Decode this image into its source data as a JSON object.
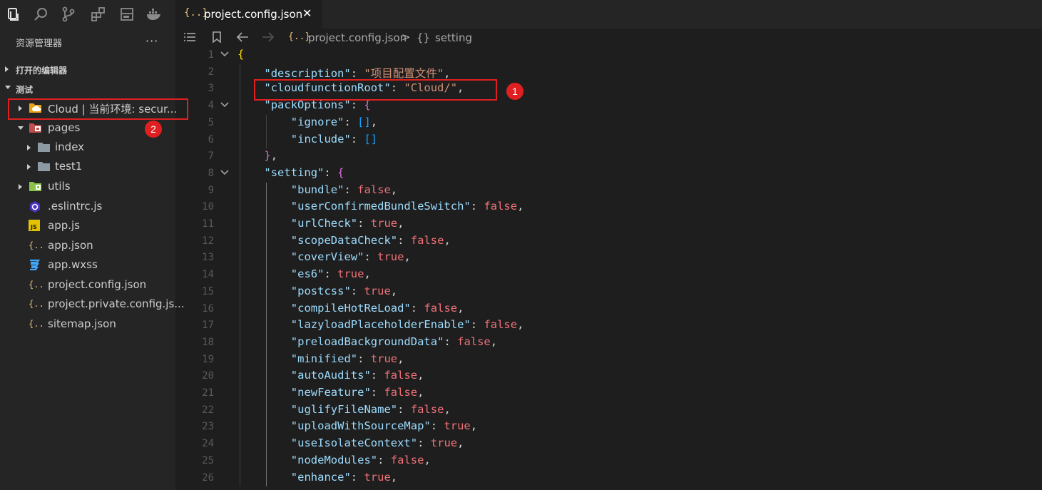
{
  "activity_icons": [
    "explorer-icon",
    "search-icon",
    "source-control-icon",
    "extensions-icon",
    "layout-icon",
    "docker-icon"
  ],
  "explorer": {
    "title": "资源管理器",
    "more": "···",
    "open_editors": "打开的编辑器",
    "workspace": "测试",
    "tree": [
      {
        "label": "Cloud | 当前环境: secur...",
        "icon": "cloud-folder-icon",
        "indent": 0,
        "expandable": true
      },
      {
        "label": "pages",
        "icon": "pages-folder-icon",
        "indent": 0,
        "expandable": true,
        "expanded": true
      },
      {
        "label": "index",
        "icon": "folder-icon",
        "indent": 1,
        "expandable": true
      },
      {
        "label": "test1",
        "icon": "folder-icon",
        "indent": 1,
        "expandable": true
      },
      {
        "label": "utils",
        "icon": "utils-folder-icon",
        "indent": 0,
        "expandable": true
      },
      {
        "label": ".eslintrc.js",
        "icon": "eslint-icon",
        "indent": 0
      },
      {
        "label": "app.js",
        "icon": "js-icon",
        "indent": 0
      },
      {
        "label": "app.json",
        "icon": "json-icon",
        "indent": 0
      },
      {
        "label": "app.wxss",
        "icon": "css-icon",
        "indent": 0
      },
      {
        "label": "project.config.json",
        "icon": "json-icon",
        "indent": 0
      },
      {
        "label": "project.private.config.js...",
        "icon": "json-icon",
        "indent": 0
      },
      {
        "label": "sitemap.json",
        "icon": "json-icon",
        "indent": 0
      }
    ]
  },
  "tab": {
    "icon": "{..}",
    "label": "project.config.json",
    "close": "✕"
  },
  "breadcrumb": {
    "file_icon": "{..}",
    "file": "project.config.json",
    "sep": ">",
    "obj_icon": "{}",
    "setting": "setting"
  },
  "annotations": {
    "badge1": "1",
    "badge2": "2"
  },
  "code": [
    {
      "n": "1",
      "fold": true,
      "parts": [
        [
          "br",
          "{"
        ]
      ]
    },
    {
      "n": "2",
      "parts": [
        [
          "k",
          "\"description\""
        ],
        [
          "p",
          ": "
        ],
        [
          "s",
          "\"项目配置文件\""
        ],
        [
          "p",
          ","
        ]
      ]
    },
    {
      "n": "3",
      "parts": [
        [
          "k",
          "\"cloudfunctionRoot\""
        ],
        [
          "p",
          ": "
        ],
        [
          "s",
          "\"Cloud/\""
        ],
        [
          "p",
          ","
        ]
      ]
    },
    {
      "n": "4",
      "fold": true,
      "parts": [
        [
          "k",
          "\"packOptions\""
        ],
        [
          "p",
          ": "
        ],
        [
          "br2",
          "{"
        ]
      ]
    },
    {
      "n": "5",
      "parts": [
        [
          "k",
          "\"ignore\""
        ],
        [
          "p",
          ": "
        ],
        [
          "br3",
          "[]"
        ],
        [
          "p",
          ","
        ]
      ]
    },
    {
      "n": "6",
      "parts": [
        [
          "k",
          "\"include\""
        ],
        [
          "p",
          ": "
        ],
        [
          "br3",
          "[]"
        ]
      ]
    },
    {
      "n": "7",
      "parts": [
        [
          "br2",
          "}"
        ],
        [
          "p",
          ","
        ]
      ]
    },
    {
      "n": "8",
      "fold": true,
      "parts": [
        [
          "k",
          "\"setting\""
        ],
        [
          "p",
          ": "
        ],
        [
          "br2",
          "{"
        ]
      ]
    },
    {
      "n": "9",
      "parts": [
        [
          "k",
          "\"bundle\""
        ],
        [
          "p",
          ": "
        ],
        [
          "b",
          "false"
        ],
        [
          "p",
          ","
        ]
      ]
    },
    {
      "n": "10",
      "parts": [
        [
          "k",
          "\"userConfirmedBundleSwitch\""
        ],
        [
          "p",
          ": "
        ],
        [
          "b",
          "false"
        ],
        [
          "p",
          ","
        ]
      ]
    },
    {
      "n": "11",
      "parts": [
        [
          "k",
          "\"urlCheck\""
        ],
        [
          "p",
          ": "
        ],
        [
          "b",
          "true"
        ],
        [
          "p",
          ","
        ]
      ]
    },
    {
      "n": "12",
      "parts": [
        [
          "k",
          "\"scopeDataCheck\""
        ],
        [
          "p",
          ": "
        ],
        [
          "b",
          "false"
        ],
        [
          "p",
          ","
        ]
      ]
    },
    {
      "n": "13",
      "parts": [
        [
          "k",
          "\"coverView\""
        ],
        [
          "p",
          ": "
        ],
        [
          "b",
          "true"
        ],
        [
          "p",
          ","
        ]
      ]
    },
    {
      "n": "14",
      "parts": [
        [
          "k",
          "\"es6\""
        ],
        [
          "p",
          ": "
        ],
        [
          "b",
          "true"
        ],
        [
          "p",
          ","
        ]
      ]
    },
    {
      "n": "15",
      "parts": [
        [
          "k",
          "\"postcss\""
        ],
        [
          "p",
          ": "
        ],
        [
          "b",
          "true"
        ],
        [
          "p",
          ","
        ]
      ]
    },
    {
      "n": "16",
      "parts": [
        [
          "k",
          "\"compileHotReLoad\""
        ],
        [
          "p",
          ": "
        ],
        [
          "b",
          "false"
        ],
        [
          "p",
          ","
        ]
      ]
    },
    {
      "n": "17",
      "parts": [
        [
          "k",
          "\"lazyloadPlaceholderEnable\""
        ],
        [
          "p",
          ": "
        ],
        [
          "b",
          "false"
        ],
        [
          "p",
          ","
        ]
      ]
    },
    {
      "n": "18",
      "parts": [
        [
          "k",
          "\"preloadBackgroundData\""
        ],
        [
          "p",
          ": "
        ],
        [
          "b",
          "false"
        ],
        [
          "p",
          ","
        ]
      ]
    },
    {
      "n": "19",
      "parts": [
        [
          "k",
          "\"minified\""
        ],
        [
          "p",
          ": "
        ],
        [
          "b",
          "true"
        ],
        [
          "p",
          ","
        ]
      ]
    },
    {
      "n": "20",
      "parts": [
        [
          "k",
          "\"autoAudits\""
        ],
        [
          "p",
          ": "
        ],
        [
          "b",
          "false"
        ],
        [
          "p",
          ","
        ]
      ]
    },
    {
      "n": "21",
      "parts": [
        [
          "k",
          "\"newFeature\""
        ],
        [
          "p",
          ": "
        ],
        [
          "b",
          "false"
        ],
        [
          "p",
          ","
        ]
      ]
    },
    {
      "n": "22",
      "parts": [
        [
          "k",
          "\"uglifyFileName\""
        ],
        [
          "p",
          ": "
        ],
        [
          "b",
          "false"
        ],
        [
          "p",
          ","
        ]
      ]
    },
    {
      "n": "23",
      "parts": [
        [
          "k",
          "\"uploadWithSourceMap\""
        ],
        [
          "p",
          ": "
        ],
        [
          "b",
          "true"
        ],
        [
          "p",
          ","
        ]
      ]
    },
    {
      "n": "24",
      "parts": [
        [
          "k",
          "\"useIsolateContext\""
        ],
        [
          "p",
          ": "
        ],
        [
          "b",
          "true"
        ],
        [
          "p",
          ","
        ]
      ]
    },
    {
      "n": "25",
      "parts": [
        [
          "k",
          "\"nodeModules\""
        ],
        [
          "p",
          ": "
        ],
        [
          "b",
          "false"
        ],
        [
          "p",
          ","
        ]
      ]
    },
    {
      "n": "26",
      "parts": [
        [
          "k",
          "\"enhance\""
        ],
        [
          "p",
          ": "
        ],
        [
          "b",
          "true"
        ],
        [
          "p",
          ","
        ]
      ]
    }
  ]
}
